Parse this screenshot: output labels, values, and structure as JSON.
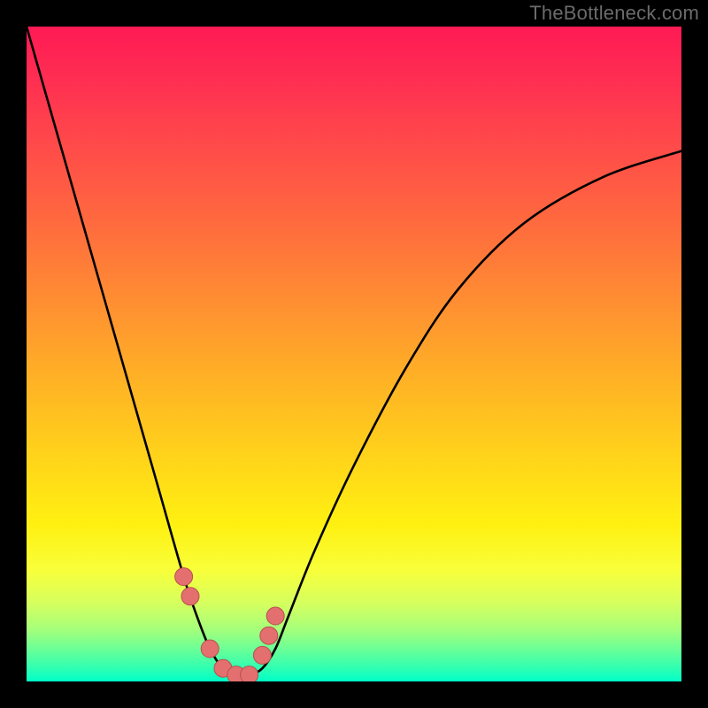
{
  "watermark": "TheBottleneck.com",
  "chart_data": {
    "type": "line",
    "title": "",
    "xlabel": "",
    "ylabel": "",
    "xlim": [
      0,
      100
    ],
    "ylim": [
      0,
      100
    ],
    "series": [
      {
        "name": "bottleneck-curve",
        "x": [
          0,
          4,
          8,
          12,
          16,
          20,
          24,
          26,
          28,
          30,
          32,
          34,
          36,
          38,
          40,
          44,
          50,
          58,
          66,
          76,
          88,
          100
        ],
        "y": [
          100,
          86,
          72,
          58,
          44,
          30,
          16,
          10,
          5,
          2,
          1,
          1,
          2,
          5,
          10,
          20,
          33,
          48,
          60,
          70,
          77,
          81
        ]
      }
    ],
    "markers": {
      "name": "highlight-dots",
      "color": "#e36f6f",
      "x": [
        24,
        25,
        28,
        30,
        32,
        34,
        36,
        37,
        38
      ],
      "y": [
        16,
        13,
        5,
        2,
        1,
        1,
        4,
        7,
        10
      ]
    },
    "gradient_stops": [
      {
        "pos": 0,
        "color": "#ff1a54"
      },
      {
        "pos": 8,
        "color": "#ff2e52"
      },
      {
        "pos": 18,
        "color": "#ff4a4a"
      },
      {
        "pos": 30,
        "color": "#ff6a3e"
      },
      {
        "pos": 42,
        "color": "#ff8e32"
      },
      {
        "pos": 54,
        "color": "#ffb225"
      },
      {
        "pos": 66,
        "color": "#ffd41a"
      },
      {
        "pos": 76,
        "color": "#fff011"
      },
      {
        "pos": 83,
        "color": "#f8ff3a"
      },
      {
        "pos": 88,
        "color": "#d6ff5e"
      },
      {
        "pos": 92,
        "color": "#a6ff7a"
      },
      {
        "pos": 95,
        "color": "#6cff96"
      },
      {
        "pos": 98,
        "color": "#2effb2"
      },
      {
        "pos": 100,
        "color": "#00ffc8"
      }
    ]
  }
}
